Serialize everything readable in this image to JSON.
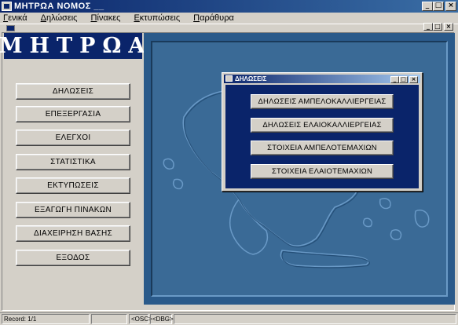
{
  "window": {
    "title": "ΜΗΤΡΩΑ  ΝΟΜΟΣ  __"
  },
  "window_controls": {
    "minimize": "_",
    "maximize": "□",
    "close": "×"
  },
  "menu": [
    {
      "pre": "",
      "u": "Γ",
      "post": "ενικά"
    },
    {
      "pre": "",
      "u": "Δ",
      "post": "ηλώσεις"
    },
    {
      "pre": "",
      "u": "Π",
      "post": "ίνακες"
    },
    {
      "pre": "",
      "u": "Ε",
      "post": "κτυπώσεις"
    },
    {
      "pre": "",
      "u": "Π",
      "post": "αράθυρα"
    }
  ],
  "logo": {
    "text": "ΜΗΤΡΩΑ"
  },
  "sidebar": {
    "buttons": [
      {
        "label": "ΔΗΛΩΣΕΙΣ"
      },
      {
        "label": "ΕΠΕΞΕΡΓΑΣΙΑ"
      },
      {
        "label": "ΕΛΕΓΧΟΙ"
      },
      {
        "label": "ΣΤΑΤΙΣΤΙΚΑ"
      },
      {
        "label": "ΕΚΤΥΠΩΣΕΙΣ"
      },
      {
        "label": "ΕΞΑΓΩΓΗ ΠΙΝΑΚΩΝ"
      },
      {
        "label": "ΔΙΑΧΕΙΡΗΣΗ ΒΑΣΗΣ"
      },
      {
        "label": "ΕΞΟΔΟΣ"
      }
    ]
  },
  "dialog": {
    "title": "ΔΗΛΩΣΕΙΣ",
    "buttons": [
      {
        "label": "ΔΗΛΩΣΕΙΣ ΑΜΠΕΛΟΚΑΛΛΙΕΡΓΕΙΑΣ"
      },
      {
        "label": "ΔΗΛΩΣΕΙΣ ΕΛΑΙΟΚΑΛΛΙΕΡΓΕΙΑΣ"
      },
      {
        "label": "ΣΤΟΙΧΕΙΑ ΑΜΠΕΛΟΤΕΜΑΧΙΩΝ"
      },
      {
        "label": "ΣΤΟΙΧΕΙΑ ΕΛΑΙΟΤΕΜΑΧΙΩΝ"
      }
    ]
  },
  "statusbar": {
    "record": "Record: 1/1",
    "osc": "<OSC>",
    "dbg": "<DBG>"
  },
  "colors": {
    "title_bar": "#0a246a",
    "map_background": "#2a5a8a",
    "face": "#d4d0c8"
  }
}
